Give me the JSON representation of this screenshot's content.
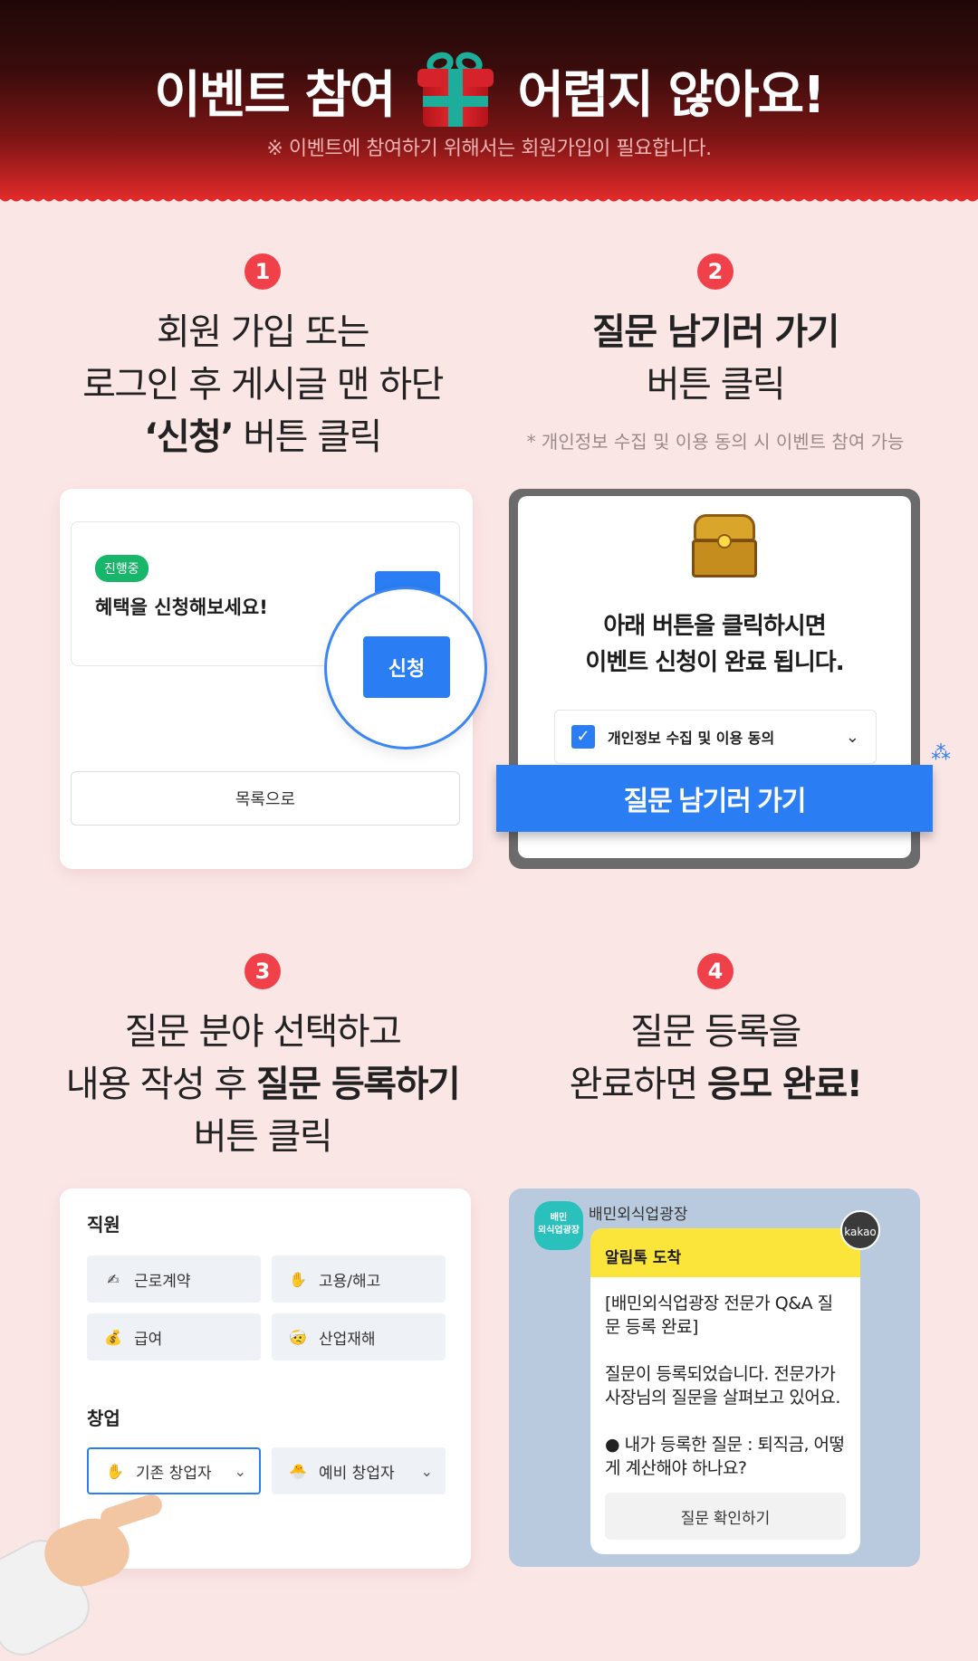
{
  "header": {
    "title_left": "이벤트 참여",
    "title_right": "어렵지 않아요!",
    "subtitle": "※ 이벤트에 참여하기 위해서는 회원가입이 필요합니다."
  },
  "steps": [
    {
      "num": "1",
      "line1": "회원 가입 또는",
      "line2": "로그인 후 게시글 맨 하단",
      "line3_bold": "‘신청’",
      "line3_rest": " 버튼 클릭"
    },
    {
      "num": "2",
      "line1_bold": "질문 남기러 가기",
      "line2": "버튼 클릭",
      "note": "* 개인정보 수집 및 이용 동의 시 이벤트 참여 가능"
    },
    {
      "num": "3",
      "line1": "질문 분야 선택하고",
      "line2_pre": "내용 작성 후 ",
      "line2_bold": "질문 등록하기",
      "line3": "버튼 클릭"
    },
    {
      "num": "4",
      "line1": "질문 등록을",
      "line2_pre": "완료하면 ",
      "line2_bold": "응모 완료!"
    }
  ],
  "card1": {
    "badge": "진행중",
    "title": "혜택을 신청해보세요!",
    "apply_button": "신청",
    "list_button": "목록으로"
  },
  "card2": {
    "message_line1": "아래 버튼을 클릭하시면",
    "message_line2": "이벤트 신청이 완료 됩니다.",
    "agree_label": "개인정보 수집 및 이용 동의",
    "go_button": "질문 남기러 가기"
  },
  "card3": {
    "section1": "직원",
    "section2": "창업",
    "chips": [
      {
        "label": "근로계약",
        "icon": "✍"
      },
      {
        "label": "고용/해고",
        "icon": "✋"
      },
      {
        "label": "급여",
        "icon": "💰"
      },
      {
        "label": "산업재해",
        "icon": "🤕"
      },
      {
        "label": "기존 창업자",
        "icon": "✋"
      },
      {
        "label": "예비 창업자",
        "icon": "🐣"
      }
    ]
  },
  "card4": {
    "logo": "배민\n외식업광장",
    "sender": "배민외식업광장",
    "kakao": "kakao",
    "bubble_title": "알림톡 도착",
    "para1": "[배민외식업광장 전문가 Q&A 질문 등록 완료]",
    "para2": "질문이 등록되었습니다. 전문가가 사장님의 질문을 살펴보고 있어요.",
    "para3": "● 내가 등록한 질문 : 퇴직금, 어떻게 계산해야 하나요?",
    "confirm_button": "질문 확인하기"
  },
  "colors": {
    "accent_blue": "#2a7df2",
    "step_red": "#f0414a",
    "background": "#fbe6e6",
    "kakao_yellow": "#fce53b"
  }
}
